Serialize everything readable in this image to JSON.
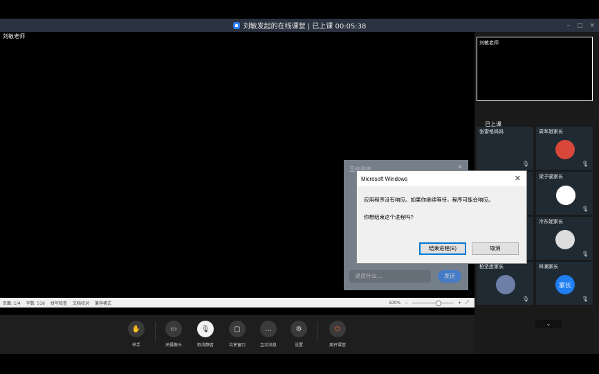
{
  "window": {
    "title": "刘敏发起的在线课堂 | 已上课 00:05:38",
    "controls": [
      "–",
      "▢",
      "×"
    ]
  },
  "stage": {
    "teacher_label": "刘敏老师"
  },
  "docbar": {
    "page": "页面: 1/4",
    "wordcount": "字数: 516",
    "spellcheck": "拼写检查",
    "proofread": "文档校对",
    "compat": "兼容模式",
    "zoom": "100%"
  },
  "toolbar": {
    "items": [
      {
        "label": "举手",
        "icon": "hand-icon"
      },
      {
        "label": "关摄像头",
        "icon": "camera-icon"
      },
      {
        "label": "取消静音",
        "icon": "mic-muted-icon"
      },
      {
        "label": "共享窗口",
        "icon": "screen-share-icon"
      },
      {
        "label": "互动消息",
        "icon": "chat-icon"
      },
      {
        "label": "设置",
        "icon": "gear-icon"
      },
      {
        "label": "离开课堂",
        "icon": "power-icon"
      }
    ]
  },
  "sidebar": {
    "preview_label": "刘敏老师",
    "status": "已上课",
    "participants": [
      {
        "name": "张雷格妈妈",
        "avatar": ""
      },
      {
        "name": "周军姐家长",
        "avatar": "photo"
      },
      {
        "name": "",
        "avatar": ""
      },
      {
        "name": "梁子骏家长",
        "avatar": "photo"
      },
      {
        "name": "",
        "avatar": ""
      },
      {
        "name": "冷东妮家长",
        "avatar": "photo"
      },
      {
        "name": "柏坚度家长",
        "avatar": "photo"
      },
      {
        "name": "林澜家长",
        "avatar": "家长"
      }
    ],
    "scroll_down": "⌄"
  },
  "chat": {
    "title": "互动消息",
    "input_placeholder": "说点什么...",
    "send": "发送"
  },
  "dialog": {
    "title": "Microsoft Windows",
    "message": "应用程序没有响应。如果你继续等待，程序可能会响应。",
    "question": "你想结束这个进程吗?",
    "end_button": "结束进程(E)",
    "cancel_button": "取消"
  },
  "colors": {
    "accent": "#2f7cf6",
    "send": "#4c87d6",
    "power": "#ff6a2b"
  }
}
